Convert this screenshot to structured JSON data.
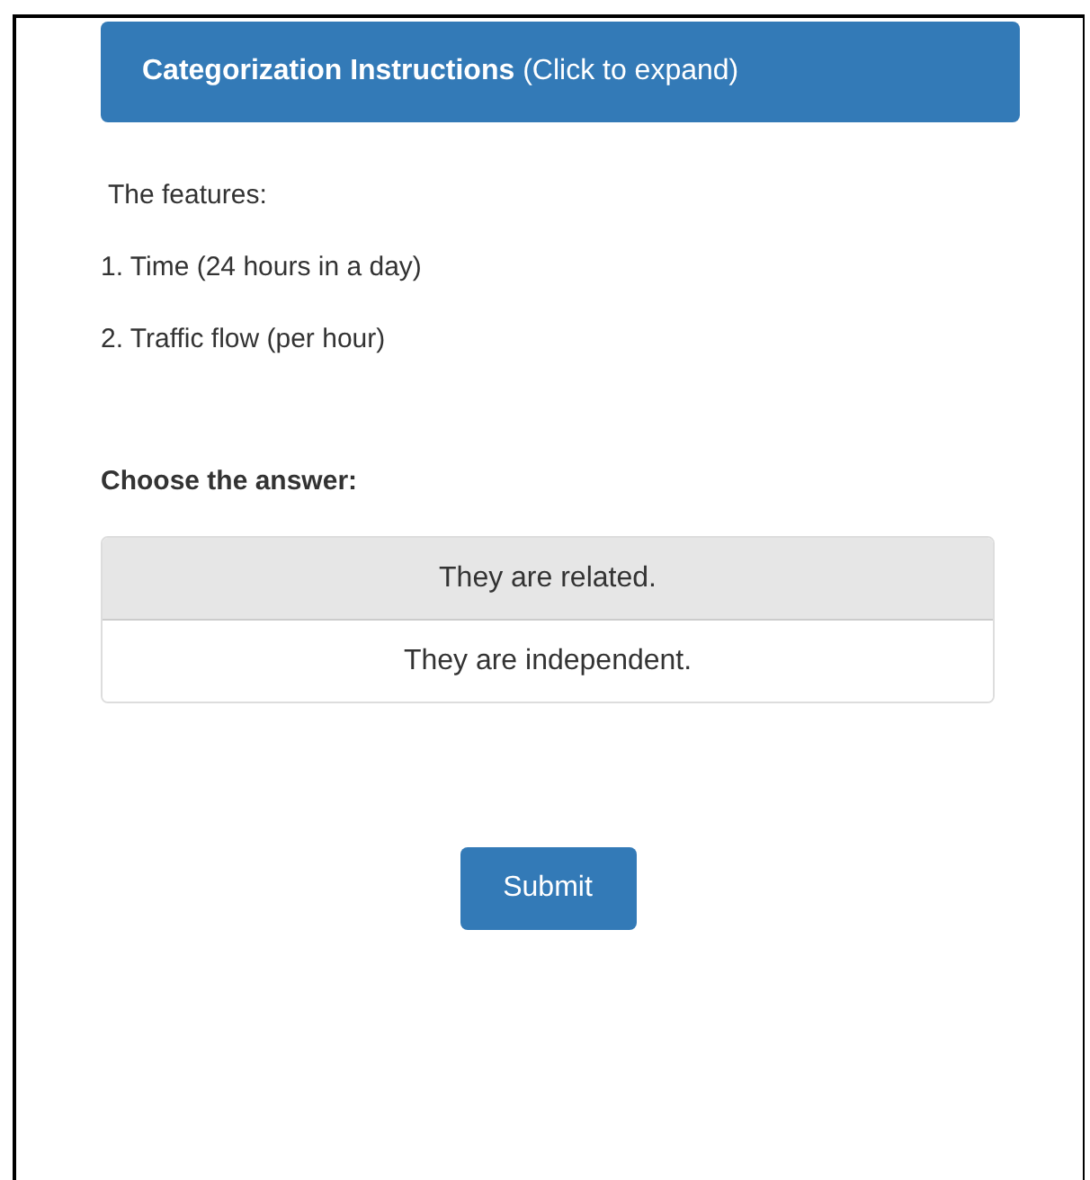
{
  "instructions_header": {
    "label": "**Categorization Instructions** (Click to expand)"
  },
  "intro": "The features:",
  "features": [
    "1. Time (24 hours in a day)",
    "2. Traffic flow (per hour)"
  ],
  "question": "Choose the answer:",
  "answers": [
    {
      "label": "They are related.",
      "selected": true
    },
    {
      "label": "They are independent.",
      "selected": false
    }
  ],
  "submit": "Submit"
}
